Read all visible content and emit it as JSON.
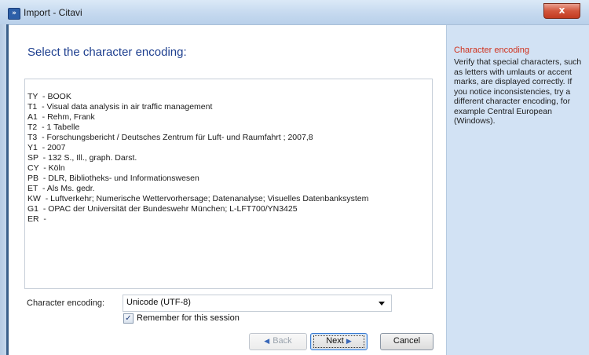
{
  "window": {
    "title": "Import - Citavi",
    "app_icon": "citavi-logo-icon",
    "close_label": "x"
  },
  "main": {
    "heading": "Select the character encoding:",
    "preview_lines": [
      "TY  - BOOK",
      "T1  - Visual data analysis in air traffic management",
      "A1  - Rehm, Frank",
      "T2  - 1 Tabelle",
      "T3  - Forschungsbericht / Deutsches Zentrum für Luft- und Raumfahrt ; 2007,8",
      "Y1  - 2007",
      "SP  - 132 S., Ill., graph. Darst.",
      "CY  - Köln",
      "PB  - DLR, Bibliotheks- und Informationswesen",
      "ET  - Als Ms. gedr.",
      "KW  - Luftverkehr; Numerische Wettervorhersage; Datenanalyse; Visuelles Datenbanksystem",
      "G1  - OPAC der Universität der Bundeswehr München; L-LFT700/YN3425",
      "ER  -"
    ],
    "encoding_label": "Character encoding:",
    "encoding_value": "Unicode (UTF-8)",
    "remember_label": "Remember for this session",
    "remember_checked": true
  },
  "buttons": {
    "back": "Back",
    "next": "Next",
    "cancel": "Cancel"
  },
  "help": {
    "title": "Character encoding",
    "text": "Verify that special characters, such as letters with umlauts or accent marks, are displayed correctly. If you notice inconsistencies, try a different character encoding, for example Central European (Windows)."
  },
  "colors": {
    "heading": "#1e3f8f",
    "help_title": "#d0311c",
    "help_bg": "#d2e2f4"
  }
}
